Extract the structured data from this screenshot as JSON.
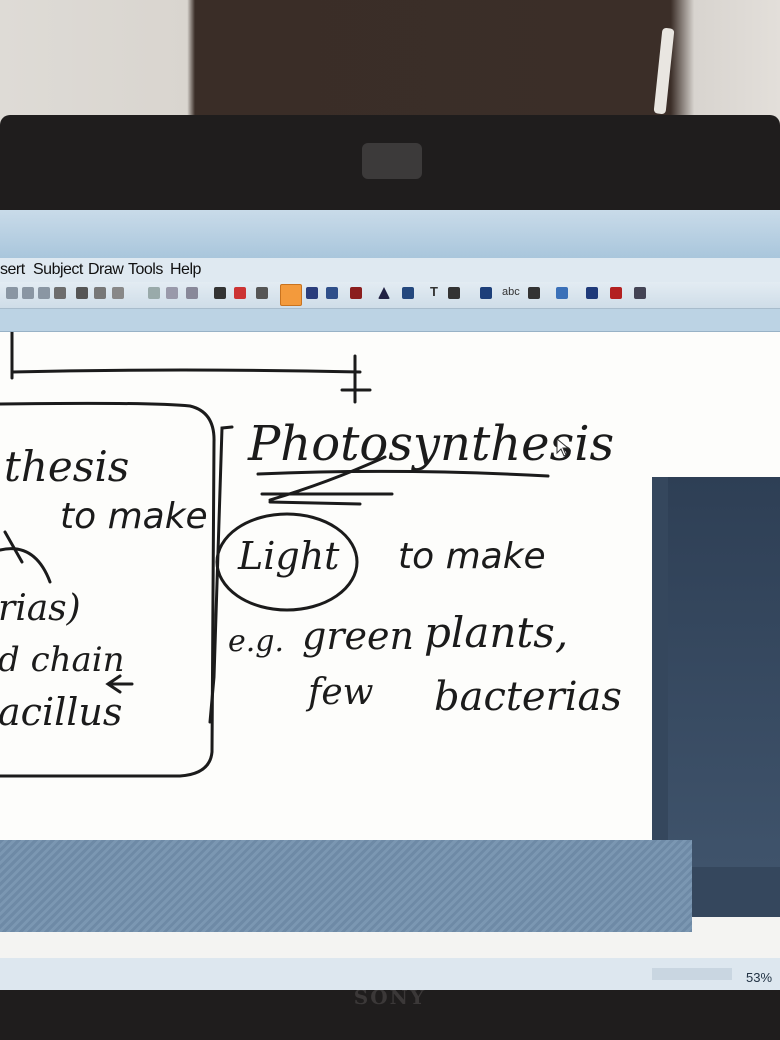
{
  "menu": {
    "items": [
      "sert",
      "Subject",
      "Draw",
      "Tools",
      "Help"
    ]
  },
  "toolbar": {
    "text_tool_label": "T",
    "abc_tool_label": "abc"
  },
  "status": {
    "zoom": "53%"
  },
  "brand": "SONY",
  "whiteboard": {
    "left_box": {
      "line1": "thesis",
      "line2": "to make",
      "line3": "rias)",
      "line4": "d chain",
      "line5": "acillus"
    },
    "title": "Photosynthesis",
    "light": "Light",
    "to_make": "to make",
    "eg": "e.g.",
    "green": "green",
    "plants": "plants,",
    "few": "few",
    "bacterias": "bacterias"
  },
  "colors": {
    "screen_bg": "#fdfdfb",
    "titlebar": "#a9c6dc",
    "ink": "#1b1b1b",
    "active_tool": "#f39a3c"
  }
}
